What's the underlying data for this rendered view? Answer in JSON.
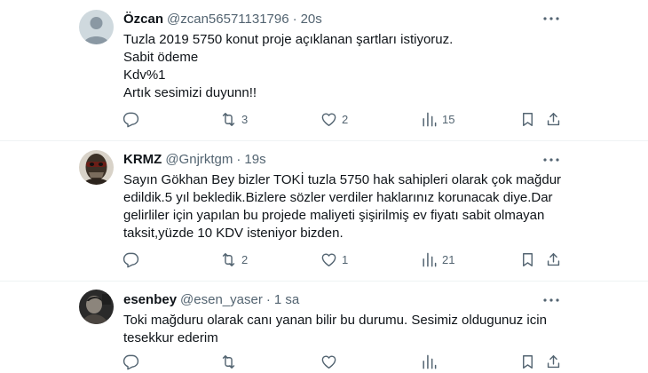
{
  "tweets": [
    {
      "name": "Özcan",
      "handle": "@zcan56571131796",
      "separator": "·",
      "time": "20s",
      "text_lines": [
        "Tuzla 2019 5750 konut proje açıklanan şartları istiyoruz.",
        "Sabit ödeme",
        "Kdv%1",
        "Artık sesimizi duyunn!!"
      ],
      "reply_count": "",
      "retweet_count": "3",
      "like_count": "2",
      "view_count": "15",
      "avatar": "default-person-avatar"
    },
    {
      "name": "KRMZ",
      "handle": "@Gnjrktgm",
      "separator": "·",
      "time": "19s",
      "text_lines": [
        "Sayın Gökhan Bey bizler TOKİ tuzla 5750 hak sahipleri olarak çok mağdur",
        "edildik.5 yıl bekledik.Bizlere sözler verdiler haklarınız korunacak diye.Dar",
        "gelirliler için yapılan bu projede maliyeti şişirilmiş ev fiyatı sabit olmayan",
        "taksit,yüzde 10 KDV isteniyor bizden."
      ],
      "reply_count": "",
      "retweet_count": "2",
      "like_count": "1",
      "view_count": "21",
      "avatar": "masked-face-avatar"
    },
    {
      "name": "esenbey",
      "handle": "@esen_yaser",
      "separator": "·",
      "time": "1 sa",
      "text_lines": [
        "Toki mağduru olarak canı yanan bilir bu durumu. Sesimiz oldugunuz icin",
        "tesekkur ederim"
      ],
      "reply_count": "",
      "retweet_count": "",
      "like_count": "",
      "view_count": "",
      "avatar": "dark-photo-avatar"
    }
  ],
  "icons": {
    "reply": "reply-icon",
    "retweet": "retweet-icon",
    "like": "heart-icon",
    "views": "views-icon",
    "bookmark": "bookmark-icon",
    "share": "share-icon",
    "more": "more-icon"
  },
  "colors": {
    "text": "#0f1419",
    "secondary": "#536471",
    "divider": "#eff3f4"
  }
}
